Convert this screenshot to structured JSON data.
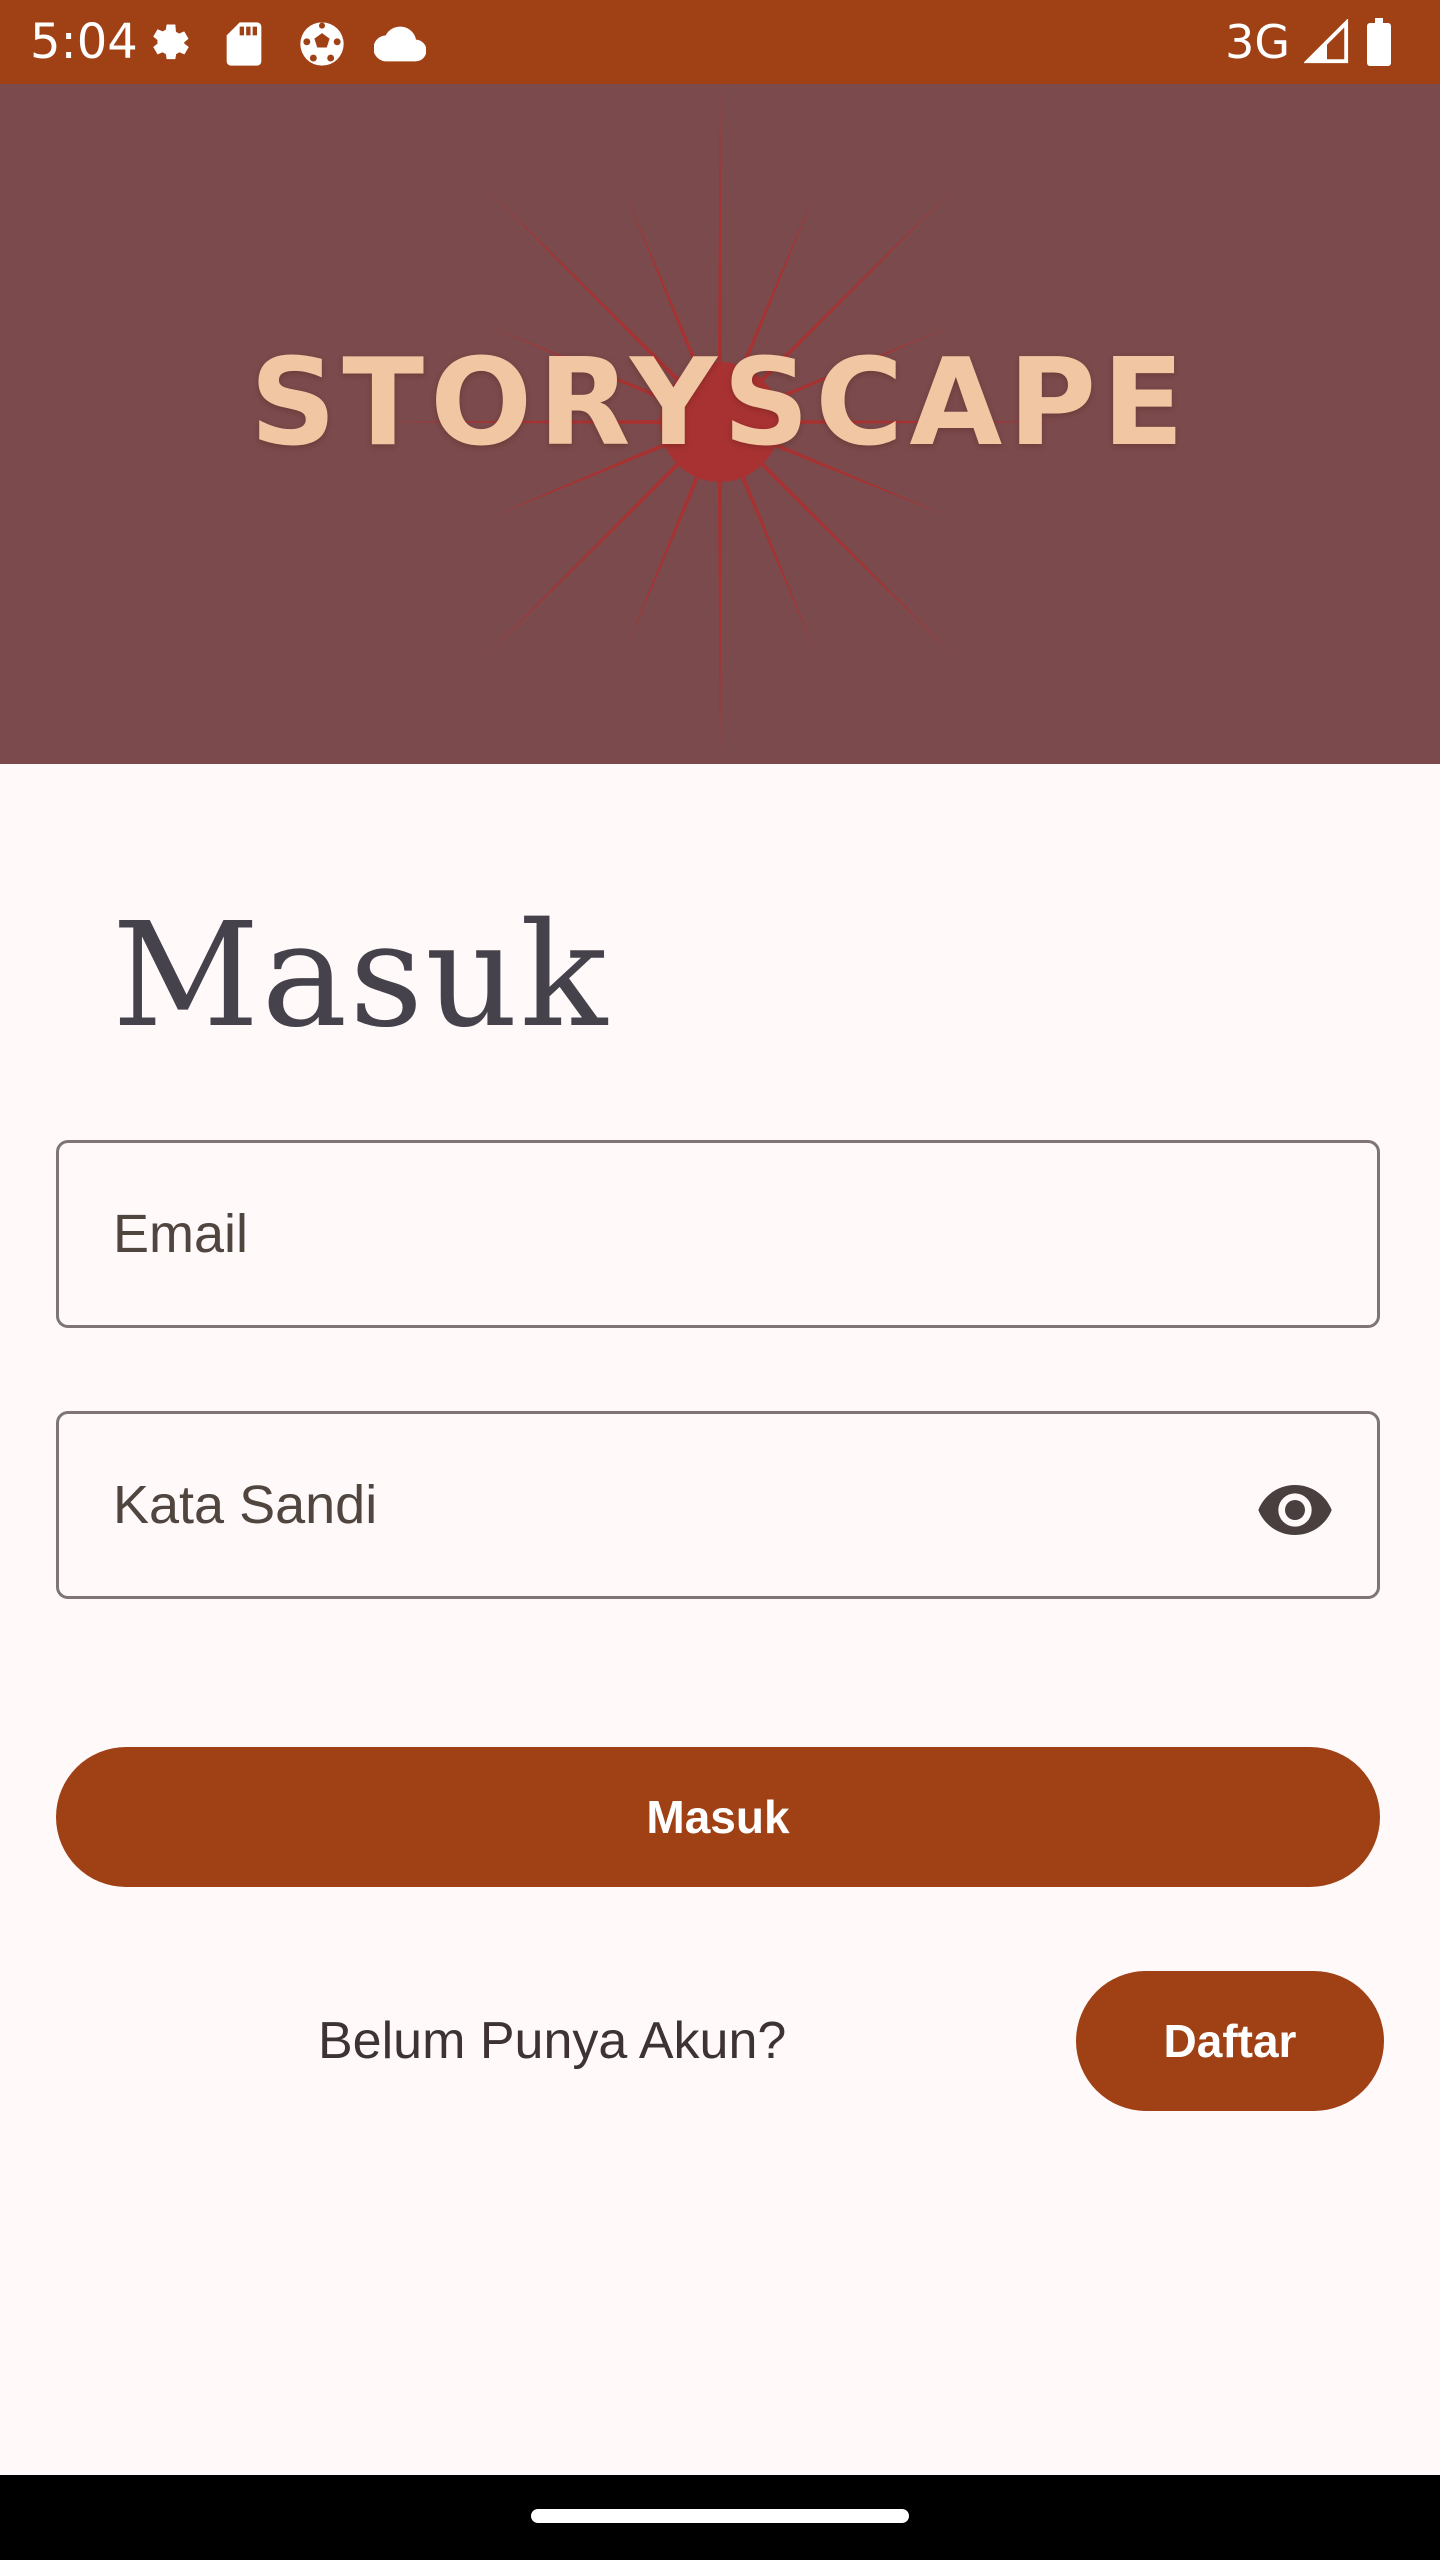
{
  "status_bar": {
    "time": "5:04",
    "network": "3G",
    "icons": [
      "settings-icon",
      "sd-card-icon",
      "soccer-ball-icon",
      "cloud-icon",
      "signal-icon",
      "battery-icon"
    ]
  },
  "banner": {
    "logo_text": "STORYSCAPE",
    "background_color": "#7b4a4c",
    "star_color": "#a83232",
    "text_color": "#f1c7a3"
  },
  "page": {
    "title": "Masuk"
  },
  "form": {
    "email_placeholder": "Email",
    "password_placeholder": "Kata Sandi",
    "password_toggle_icon": "eye-icon",
    "submit_label": "Masuk"
  },
  "signup": {
    "prompt": "Belum Punya Akun?",
    "button_label": "Daftar"
  },
  "colors": {
    "primary": "#a04015",
    "background": "#fff9fa",
    "outline": "#7f7478"
  }
}
